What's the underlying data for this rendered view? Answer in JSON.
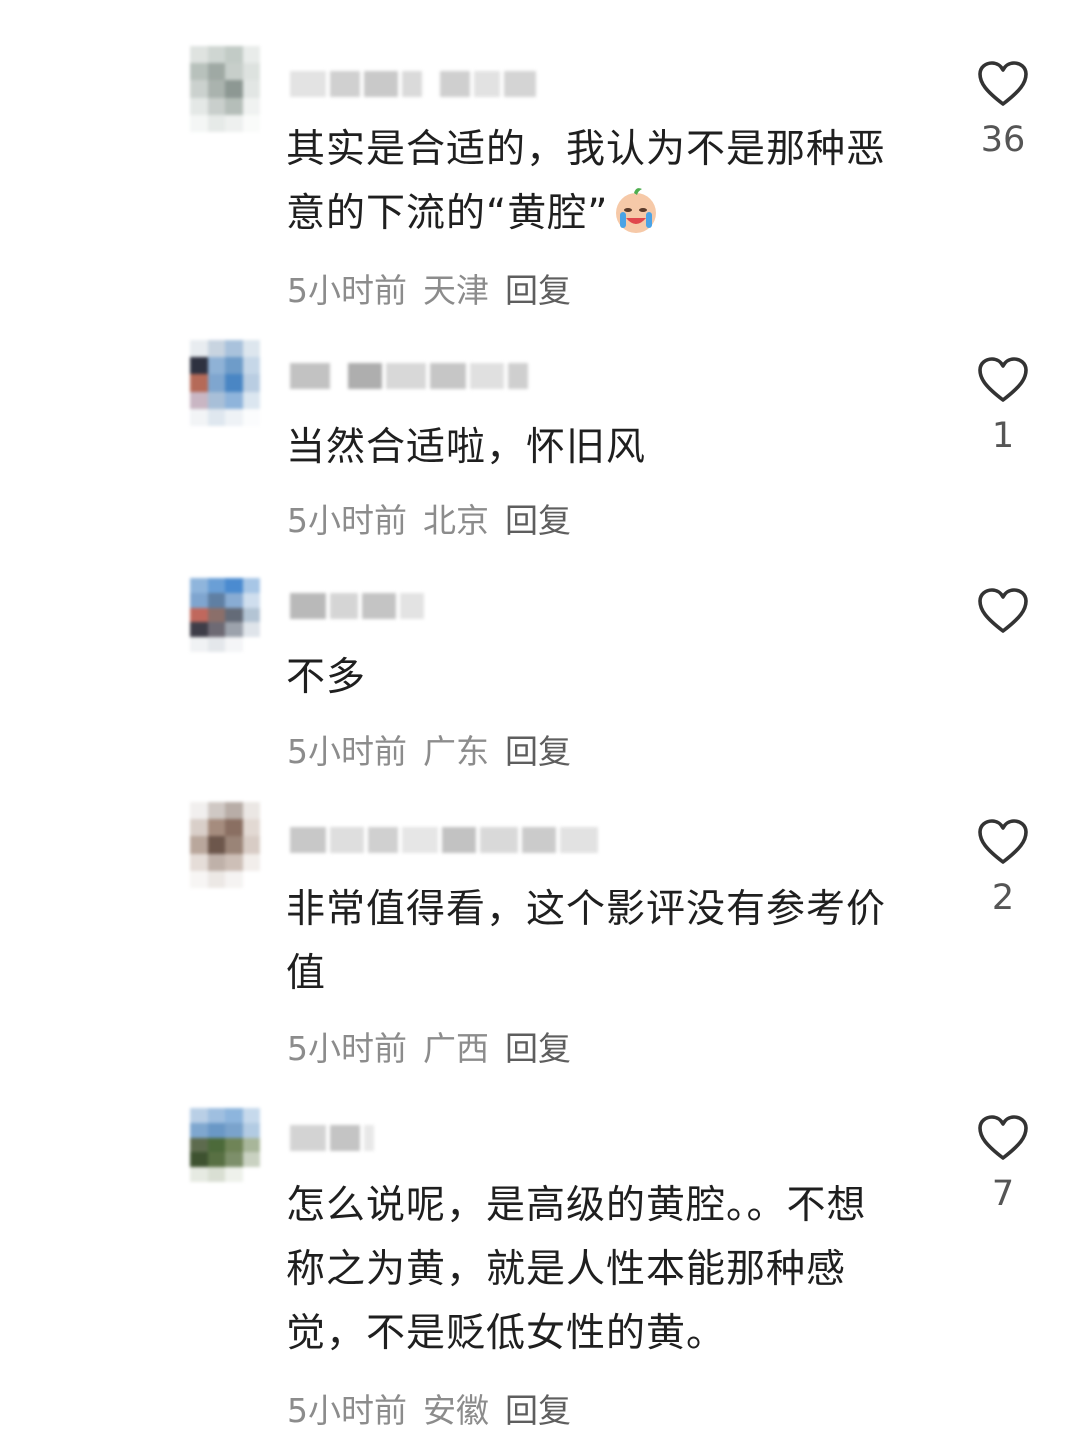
{
  "comments": [
    {
      "text_lines": [
        "其实是合适的，我认为不是那种恶",
        "意的下流的“黄腔”"
      ],
      "emoji": "crying-laughing-baby-emoji",
      "time": "5小时前",
      "location": "天津",
      "reply_label": "回复",
      "likes": "36"
    },
    {
      "text_lines": [
        "当然合适啦，怀旧风"
      ],
      "time": "5小时前",
      "location": "北京",
      "reply_label": "回复",
      "likes": "1"
    },
    {
      "text_lines": [
        "不多"
      ],
      "time": "5小时前",
      "location": "广东",
      "reply_label": "回复",
      "likes": ""
    },
    {
      "text_lines": [
        "非常值得看，这个影评没有参考价",
        "值"
      ],
      "time": "5小时前",
      "location": "广西",
      "reply_label": "回复",
      "likes": "2"
    },
    {
      "text_lines": [
        "怎么说呢，是高级的黄腔。。不想",
        "称之为黄，就是人性本能那种感",
        "觉，不是贬低女性的黄。"
      ],
      "time": "5小时前",
      "location": "安徽",
      "reply_label": "回复",
      "likes": "7"
    }
  ],
  "icons": {
    "like": "heart-outline-icon"
  },
  "colors": {
    "text": "#1f1f1f",
    "meta": "#8c8c8c",
    "reply": "#5e5e5e",
    "heart": "#333333"
  }
}
